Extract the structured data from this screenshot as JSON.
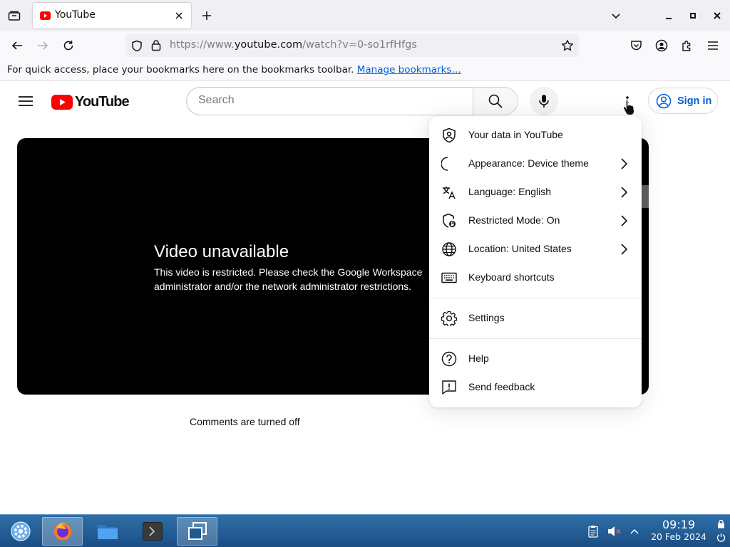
{
  "browser": {
    "tab": {
      "title": "YouTube"
    },
    "url": {
      "scheme": "https://www.",
      "host": "youtube.com",
      "path": "/watch?v=0-so1rfHfgs"
    },
    "bookmarks_bar": {
      "message": "For quick access, place your bookmarks here on the bookmarks toolbar.",
      "link": "Manage bookmarks…"
    }
  },
  "youtube": {
    "logo_text": "YouTube",
    "search": {
      "placeholder": "Search",
      "value": ""
    },
    "sign_in": "Sign in",
    "player": {
      "error_title": "Video unavailable",
      "error_message": "This video is restricted. Please check the Google Workspace administrator and/or the network administrator restrictions."
    },
    "comments": "Comments are turned off",
    "menu": {
      "group1": [
        {
          "label": "Your data in YouTube",
          "icon": "shield-person-icon",
          "submenu": false
        },
        {
          "label": "Appearance: Device theme",
          "icon": "moon-icon",
          "submenu": true
        },
        {
          "label": "Language: English",
          "icon": "translate-icon",
          "submenu": true
        },
        {
          "label": "Restricted Mode: On",
          "icon": "shield-lock-icon",
          "submenu": true
        },
        {
          "label": "Location: United States",
          "icon": "globe-icon",
          "submenu": true
        },
        {
          "label": "Keyboard shortcuts",
          "icon": "keyboard-icon",
          "submenu": false
        }
      ],
      "group2": [
        {
          "label": "Settings",
          "icon": "gear-icon",
          "submenu": false
        }
      ],
      "group3": [
        {
          "label": "Help",
          "icon": "help-icon",
          "submenu": false
        },
        {
          "label": "Send feedback",
          "icon": "feedback-icon",
          "submenu": false
        }
      ]
    }
  },
  "taskbar": {
    "clock": {
      "time": "09:19",
      "date": "20 Feb 2024"
    }
  },
  "colors": {
    "yt_red": "#ff0000",
    "link_blue": "#065fd4",
    "taskbar": "#1f5a92"
  }
}
